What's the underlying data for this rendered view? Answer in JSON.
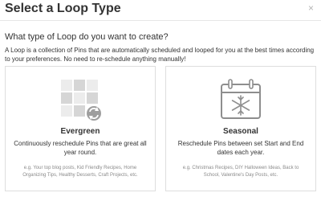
{
  "modal": {
    "title": "Select a Loop Type",
    "close_label": "×"
  },
  "question": "What type of Loop do you want to create?",
  "description": "A Loop is a collection of Pins that are automatically scheduled and looped for you at the best times according to your preferences. No need to re-schedule anything manually!",
  "cards": [
    {
      "title": "Evergreen",
      "description": "Continuously reschedule Pins that are great all year round.",
      "examples": "e.g. Your top blog posts, Kid Friendly Recipes, Home Organizing Tips, Healthy Desserts, Craft Projects, etc.",
      "icon": "grid-refresh-icon"
    },
    {
      "title": "Seasonal",
      "description": "Reschedule Pins between set Start and End dates each year.",
      "examples": "e.g. Christmas Recipes, DIY Halloween Ideas, Back to School, Valentine's Day Posts, etc.",
      "icon": "calendar-snowflake-icon"
    }
  ],
  "colors": {
    "icon_grey": "#c8c8c8",
    "icon_light": "#ececec",
    "border": "#dedede"
  }
}
